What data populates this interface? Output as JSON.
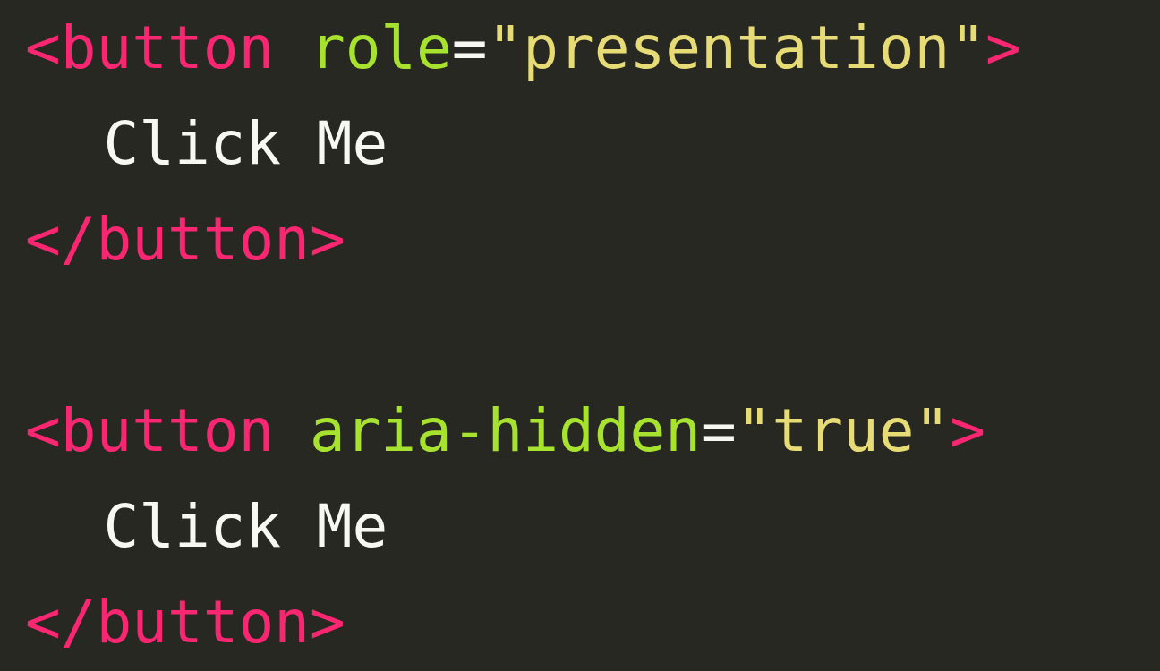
{
  "code": {
    "blocks": [
      {
        "lines": [
          {
            "indented": false,
            "tokens": [
              {
                "kind": "tag",
                "text": "<button"
              },
              {
                "kind": "attr",
                "text": "role"
              },
              {
                "kind": "punct",
                "text": "="
              },
              {
                "kind": "string",
                "text": "\"presentation\""
              },
              {
                "kind": "tag",
                "text": ">"
              }
            ]
          },
          {
            "indented": true,
            "tokens": [
              {
                "kind": "text",
                "text": "Click Me"
              }
            ]
          },
          {
            "indented": false,
            "tokens": [
              {
                "kind": "tag",
                "text": "</button>"
              }
            ]
          }
        ]
      },
      {
        "lines": [
          {
            "indented": false,
            "tokens": [
              {
                "kind": "tag",
                "text": "<button"
              },
              {
                "kind": "attr",
                "text": "aria-hidden"
              },
              {
                "kind": "punct",
                "text": "="
              },
              {
                "kind": "string",
                "text": "\"true\""
              },
              {
                "kind": "tag",
                "text": ">"
              }
            ]
          },
          {
            "indented": true,
            "tokens": [
              {
                "kind": "text",
                "text": "Click Me"
              }
            ]
          },
          {
            "indented": false,
            "tokens": [
              {
                "kind": "tag",
                "text": "</button>"
              }
            ]
          }
        ]
      }
    ]
  }
}
